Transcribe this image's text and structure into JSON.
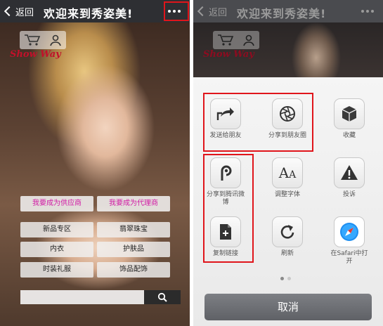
{
  "left": {
    "nav": {
      "back": "返回",
      "title": "欢迎来到秀姿美!"
    },
    "logo": {
      "brand": "Show Way"
    },
    "buttons": {
      "supplier": "我要成为供应商",
      "agent": "我要成为代理商",
      "new": "新品专区",
      "jade": "翡翠珠宝",
      "underwear": "内衣",
      "skincare": "护肤品",
      "fashion": "时装礼服",
      "accessory": "饰品配饰"
    },
    "search": {
      "placeholder": ""
    }
  },
  "right": {
    "nav": {
      "back": "返回",
      "title": "欢迎来到秀姿美!"
    },
    "logo": {
      "brand": "Show Way"
    },
    "share_items": {
      "send_friend": "发送给朋友",
      "moments": "分享到朋友圈",
      "favorite": "收藏",
      "weibo": "分享到腾讯微博",
      "font": "调整字体",
      "report": "投诉",
      "copy_link": "复制链接",
      "refresh": "刷新",
      "safari": "在Safari中打开"
    },
    "cancel": "取消"
  },
  "colors": {
    "highlight": "#e0151b",
    "pink_text": "#d11aa5",
    "navbar": "#2e2f33"
  }
}
